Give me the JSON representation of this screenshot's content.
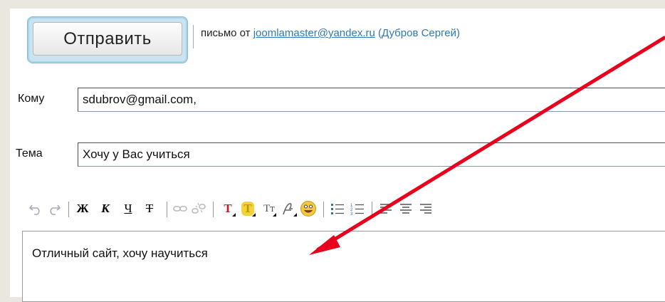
{
  "send": {
    "label": "Отправить"
  },
  "from": {
    "prefix": "письмо от",
    "email": "joomlamaster@yandex.ru",
    "name": "(Дубров Сергей)"
  },
  "to": {
    "label": "Кому",
    "value": "sdubrov@gmail.com,"
  },
  "subject": {
    "label": "Тема",
    "value": "Хочу у Вас учиться"
  },
  "toolbar": {
    "bold": "Ж",
    "italic": "К",
    "underline": "Ч",
    "strike": "Т",
    "text_color": "T",
    "font_size": "Tт"
  },
  "editor": {
    "body": "Отличный сайт, хочу научиться"
  },
  "colors": {
    "accent": "#2f79b9",
    "arrow": "#e8001c",
    "button_frame": "#c9e3f1"
  },
  "icons": [
    "undo-icon",
    "redo-icon",
    "link-icon",
    "unlink-icon",
    "text-color-icon",
    "background-color-icon",
    "font-size-icon",
    "font-face-icon",
    "smiley-icon",
    "bullet-list-icon",
    "numbered-list-icon",
    "align-left-icon",
    "align-center-icon",
    "align-right-icon"
  ]
}
